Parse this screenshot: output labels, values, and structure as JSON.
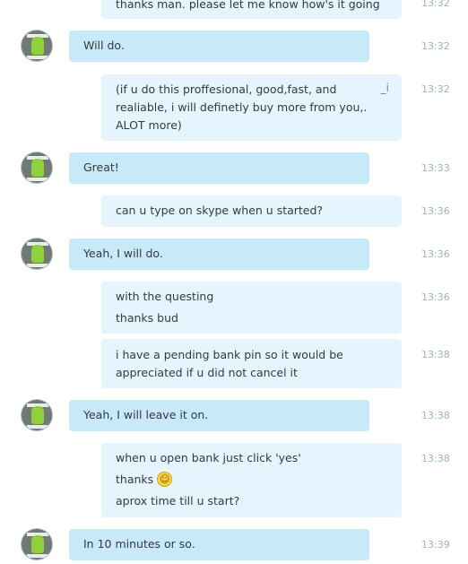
{
  "conversation": {
    "messages": [
      {
        "sender": "me",
        "time": "13:32",
        "lines": [
          "thanks man. please let me know how's it going"
        ]
      },
      {
        "sender": "contact",
        "time": "13:32",
        "lines": [
          "Will do."
        ]
      },
      {
        "sender": "me",
        "time": "13:32",
        "edited_icon": "edit-pencil-icon",
        "edited_glyph": "_i",
        "lines": [
          "(if u do this proffesional, good,fast, and",
          "realiable, i will definetly buy more from you,.",
          "ALOT more)"
        ]
      },
      {
        "sender": "contact",
        "time": "13:33",
        "lines": [
          "Great!"
        ]
      },
      {
        "sender": "me",
        "time": "13:36",
        "lines": [
          "can u type on skype when u started?"
        ]
      },
      {
        "sender": "contact",
        "time": "13:36",
        "lines": [
          "Yeah, I will do."
        ]
      },
      {
        "sender": "me",
        "time": "13:36",
        "lines": [
          "with the questing",
          "thanks bud"
        ]
      },
      {
        "sender": "me",
        "time": "13:38",
        "lines": [
          "i have a pending bank pin so it would be",
          "appreciated if u did not cancel it"
        ]
      },
      {
        "sender": "contact",
        "time": "13:38",
        "lines": [
          "Yeah, I will leave it on."
        ]
      },
      {
        "sender": "me",
        "time": "13:38",
        "emoticon": "smiley-icon",
        "emoticon_glyph": "☺",
        "lines": [
          "when u open bank just click 'yes'",
          "thanks",
          "aprox time till u start?"
        ]
      },
      {
        "sender": "contact",
        "time": "13:39",
        "lines": [
          "In 10 minutes or so."
        ]
      }
    ]
  },
  "colors": {
    "incoming_bubble": "#c7e9f8",
    "outgoing_bubble": "#e6f5fd",
    "timestamp": "#98b4c2",
    "text": "#333a3f"
  }
}
